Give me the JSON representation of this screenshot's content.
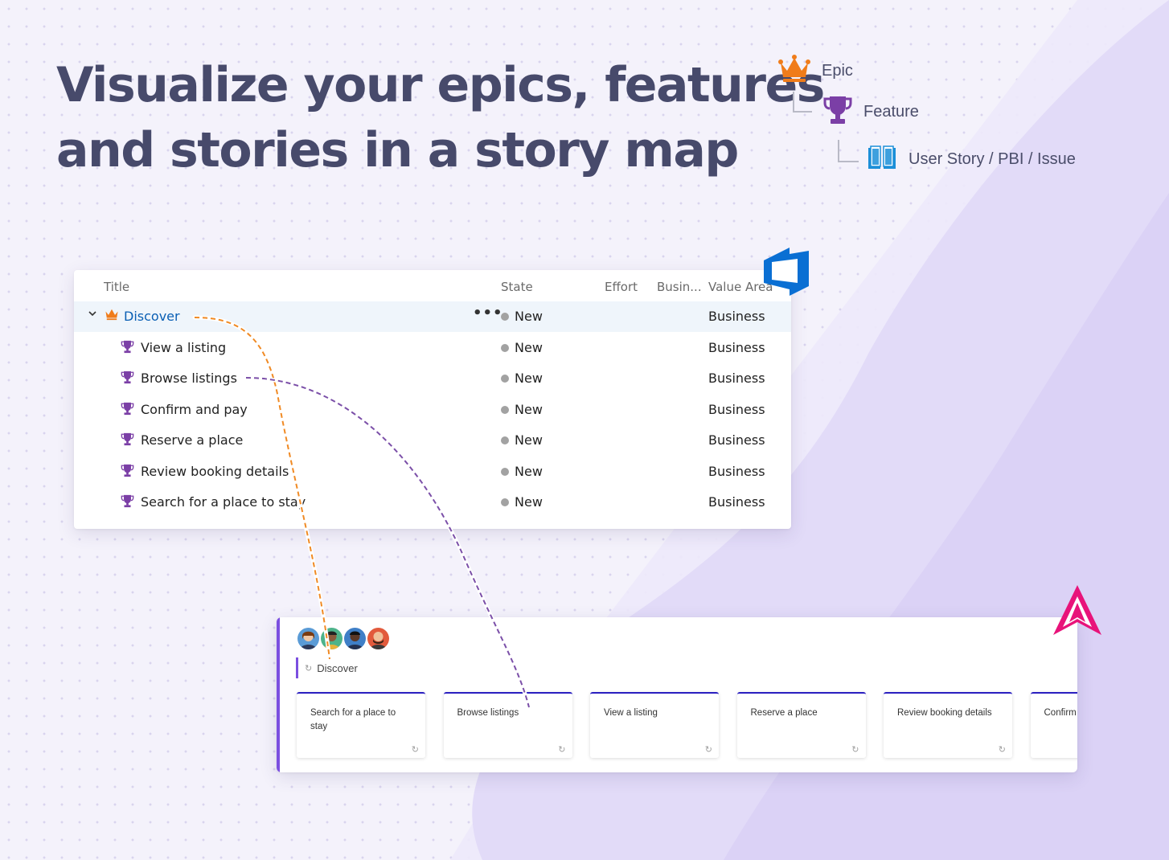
{
  "headline": {
    "line1": "Visualize your epics, features",
    "line2": "and stories in a story map"
  },
  "legend": {
    "epic": "Epic",
    "feature": "Feature",
    "story": "User Story / PBI / Issue"
  },
  "azure_table": {
    "headers": {
      "title": "Title",
      "state": "State",
      "effort": "Effort",
      "business": "Busin...",
      "value_area": "Value Area"
    },
    "epic_row": {
      "title": "Discover",
      "state": "New",
      "value_area": "Business",
      "more": "•••"
    },
    "rows": [
      {
        "title": "View a listing",
        "state": "New",
        "value_area": "Business"
      },
      {
        "title": "Browse listings",
        "state": "New",
        "value_area": "Business"
      },
      {
        "title": "Confirm and pay",
        "state": "New",
        "value_area": "Business"
      },
      {
        "title": "Reserve a place",
        "state": "New",
        "value_area": "Business"
      },
      {
        "title": "Review booking details",
        "state": "New",
        "value_area": "Business"
      },
      {
        "title": "Search for a place to stay",
        "state": "New",
        "value_area": "Business"
      }
    ]
  },
  "story_map": {
    "epic_title": "Discover",
    "cards": [
      {
        "title": "Search for a place to stay"
      },
      {
        "title": "Browse listings"
      },
      {
        "title": "View a listing"
      },
      {
        "title": "Reserve a place"
      },
      {
        "title": "Review booking details"
      },
      {
        "title": "Confirm and pay"
      }
    ]
  },
  "colors": {
    "epic_icon": "#f07c1a",
    "feature_icon": "#7b3fa6",
    "story_icon": "#1c8fd8",
    "link_epic": "#f08a24",
    "link_feature": "#7b4fa8",
    "accent_purple": "#7b4fe0",
    "card_top": "#2a1fc0",
    "azure_blue": "#0a6fd3",
    "brand_pink": "#e8137a"
  }
}
